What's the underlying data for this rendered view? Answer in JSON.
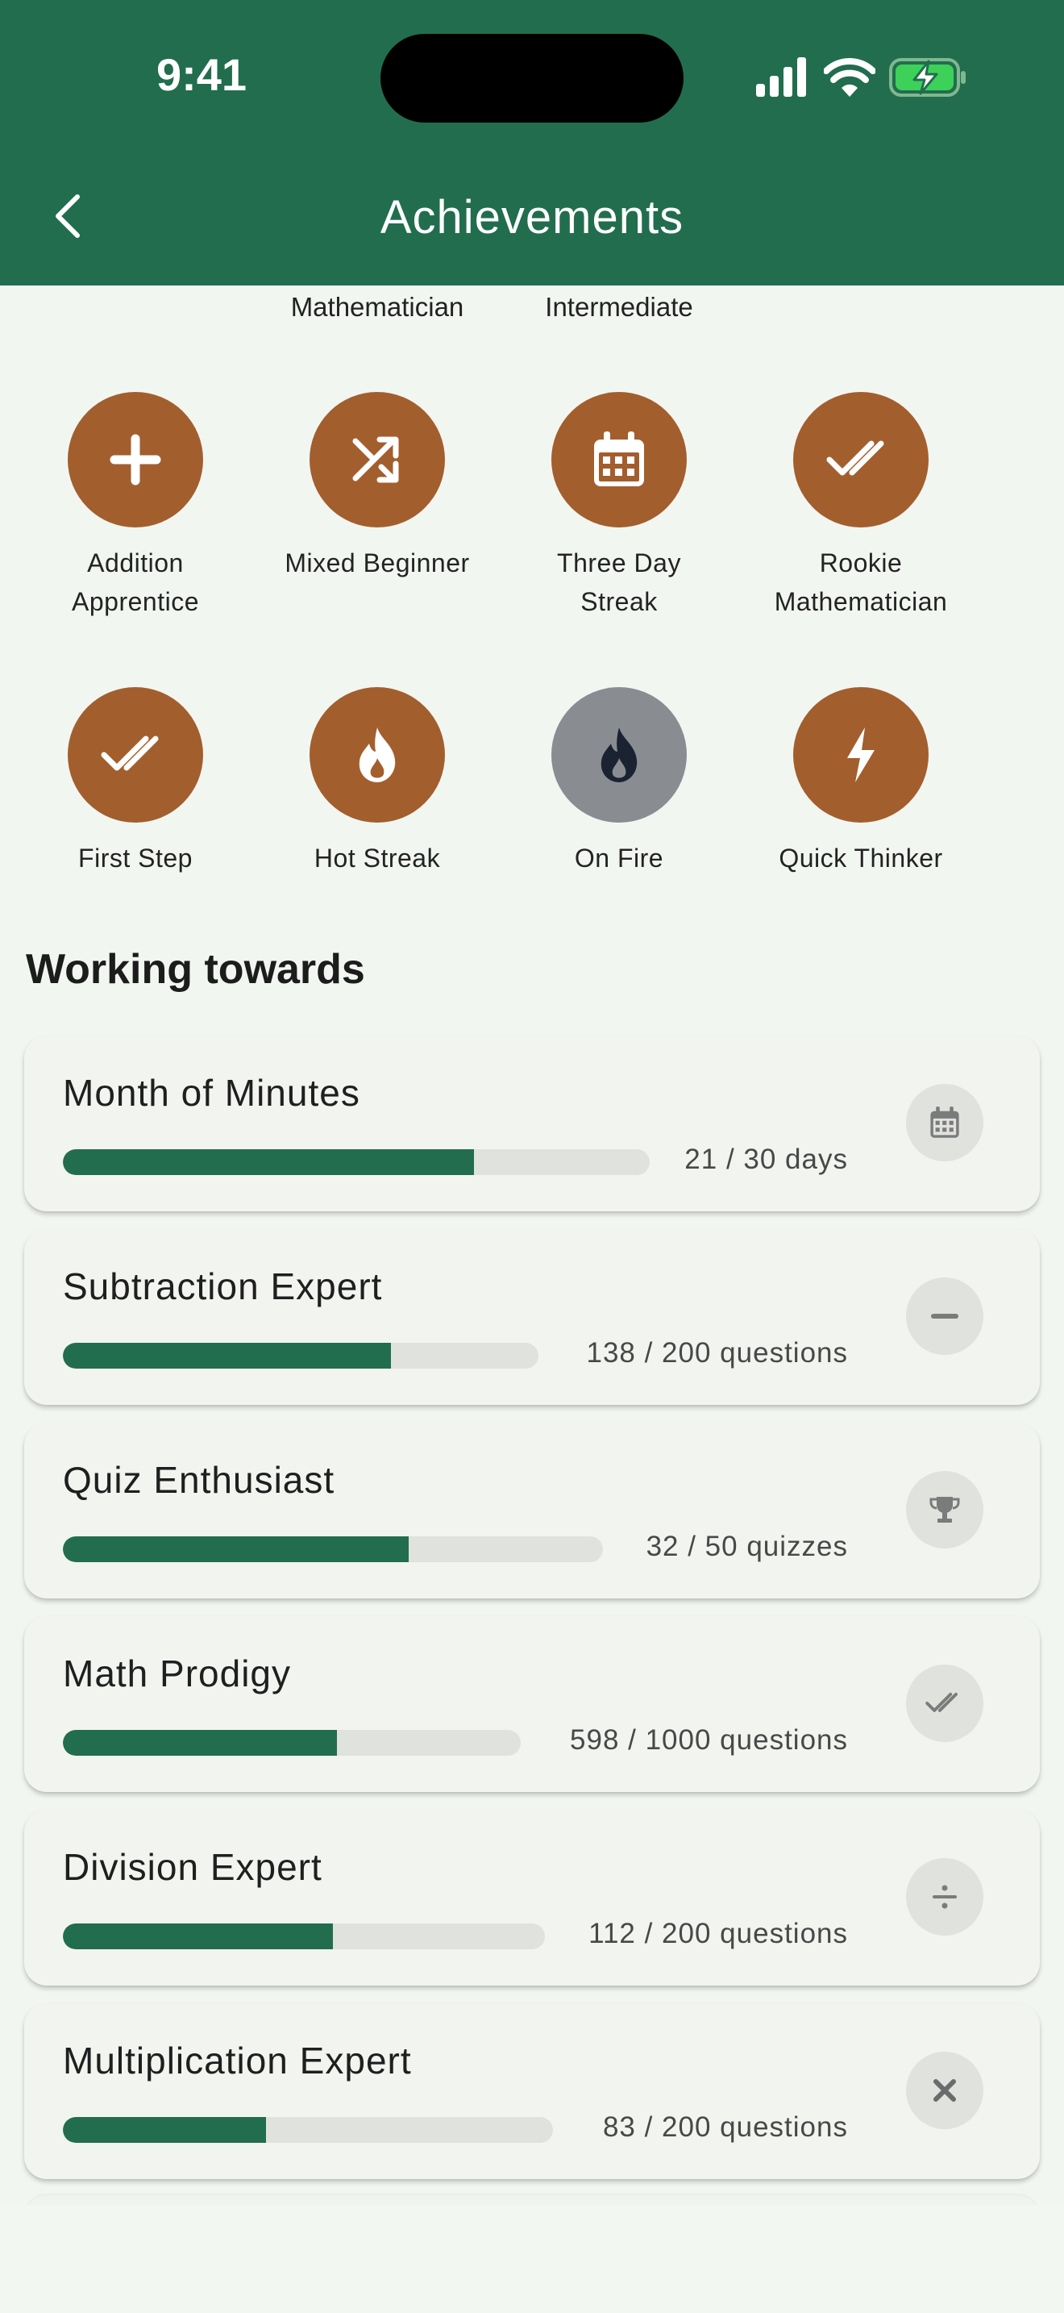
{
  "status_bar": {
    "time": "9:41"
  },
  "header": {
    "title": "Achievements"
  },
  "clipped_labels": [
    "Mathematician",
    "Intermediate"
  ],
  "earned_badges": [
    {
      "label_line1": "Addition",
      "label_line2": "Apprentice",
      "icon": "plus-icon",
      "locked": false
    },
    {
      "label_line1": "Mixed Beginner",
      "label_line2": "",
      "icon": "shuffle-icon",
      "locked": false
    },
    {
      "label_line1": "Three Day",
      "label_line2": "Streak",
      "icon": "calendar-icon",
      "locked": false
    },
    {
      "label_line1": "Rookie",
      "label_line2": "Mathematician",
      "icon": "double-check-icon",
      "locked": false
    },
    {
      "label_line1": "First Step",
      "label_line2": "",
      "icon": "double-check-icon",
      "locked": false
    },
    {
      "label_line1": "Hot Streak",
      "label_line2": "",
      "icon": "flame-icon",
      "locked": false
    },
    {
      "label_line1": "On Fire",
      "label_line2": "",
      "icon": "flame-icon",
      "locked": true
    },
    {
      "label_line1": "Quick Thinker",
      "label_line2": "",
      "icon": "lightning-icon",
      "locked": false
    }
  ],
  "working_towards": {
    "title": "Working towards",
    "items": [
      {
        "title": "Month of Minutes",
        "progress_text": "21 / 30 days",
        "progress": 0.7,
        "icon": "calendar-icon"
      },
      {
        "title": "Subtraction Expert",
        "progress_text": "138 / 200 questions",
        "progress": 0.69,
        "icon": "minus-icon"
      },
      {
        "title": "Quiz Enthusiast",
        "progress_text": "32 / 50 quizzes",
        "progress": 0.64,
        "icon": "trophy-icon"
      },
      {
        "title": "Math Prodigy",
        "progress_text": "598 / 1000 questions",
        "progress": 0.598,
        "icon": "double-check-icon"
      },
      {
        "title": "Division Expert",
        "progress_text": "112 / 200 questions",
        "progress": 0.56,
        "icon": "divide-icon"
      },
      {
        "title": "Multiplication Expert",
        "progress_text": "83 / 200 questions",
        "progress": 0.415,
        "icon": "multiply-icon"
      }
    ]
  },
  "colors": {
    "header_bg": "#226d4e",
    "badge_earned": "#a35e2e",
    "badge_locked": "#898d92",
    "progress_fill": "#226d4e",
    "progress_track": "#dfe2dd"
  }
}
